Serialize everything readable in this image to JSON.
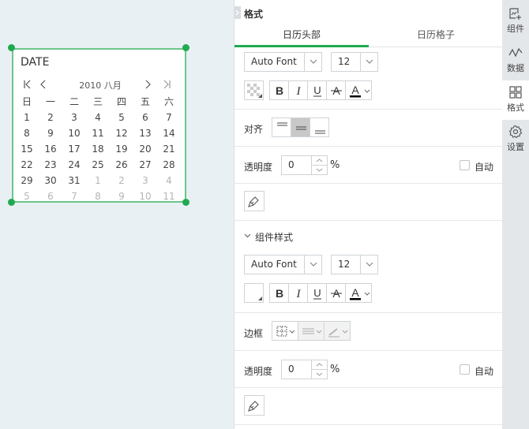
{
  "calendar": {
    "title": "DATE",
    "month_label": "2010 八月",
    "weekdays": [
      "日",
      "一",
      "二",
      "三",
      "四",
      "五",
      "六"
    ],
    "weeks": [
      [
        {
          "d": "1",
          "dim": false
        },
        {
          "d": "2",
          "dim": false
        },
        {
          "d": "3",
          "dim": false
        },
        {
          "d": "4",
          "dim": false
        },
        {
          "d": "5",
          "dim": false
        },
        {
          "d": "6",
          "dim": false
        },
        {
          "d": "7",
          "dim": false
        }
      ],
      [
        {
          "d": "8",
          "dim": false
        },
        {
          "d": "9",
          "dim": false
        },
        {
          "d": "10",
          "dim": false
        },
        {
          "d": "11",
          "dim": false
        },
        {
          "d": "12",
          "dim": false
        },
        {
          "d": "13",
          "dim": false
        },
        {
          "d": "14",
          "dim": false
        }
      ],
      [
        {
          "d": "15",
          "dim": false
        },
        {
          "d": "16",
          "dim": false
        },
        {
          "d": "17",
          "dim": false
        },
        {
          "d": "18",
          "dim": false
        },
        {
          "d": "19",
          "dim": false
        },
        {
          "d": "20",
          "dim": false
        },
        {
          "d": "21",
          "dim": false
        }
      ],
      [
        {
          "d": "22",
          "dim": false
        },
        {
          "d": "23",
          "dim": false
        },
        {
          "d": "24",
          "dim": false
        },
        {
          "d": "25",
          "dim": false
        },
        {
          "d": "26",
          "dim": false
        },
        {
          "d": "27",
          "dim": false
        },
        {
          "d": "28",
          "dim": false
        }
      ],
      [
        {
          "d": "29",
          "dim": false
        },
        {
          "d": "30",
          "dim": false
        },
        {
          "d": "31",
          "dim": false
        },
        {
          "d": "1",
          "dim": true
        },
        {
          "d": "2",
          "dim": true
        },
        {
          "d": "3",
          "dim": true
        },
        {
          "d": "4",
          "dim": true
        }
      ],
      [
        {
          "d": "5",
          "dim": true
        },
        {
          "d": "6",
          "dim": true
        },
        {
          "d": "7",
          "dim": true
        },
        {
          "d": "8",
          "dim": true
        },
        {
          "d": "9",
          "dim": true
        },
        {
          "d": "10",
          "dim": true
        },
        {
          "d": "11",
          "dim": true
        }
      ]
    ]
  },
  "panel": {
    "title": "格式",
    "tabs": [
      {
        "label": "日历头部",
        "active": true
      },
      {
        "label": "日历格子",
        "active": false
      }
    ],
    "header_section": {
      "font_family": "Auto Font",
      "font_size": "12",
      "align_label": "对齐",
      "opacity_label": "透明度",
      "opacity_value": "0",
      "opacity_unit": "%",
      "auto_label": "自动"
    },
    "widget_style_section": {
      "title": "组件样式",
      "font_family": "Auto Font",
      "font_size": "12",
      "border_label": "边框",
      "opacity_label": "透明度",
      "opacity_value": "0",
      "opacity_unit": "%",
      "auto_label": "自动"
    }
  },
  "sidebar": {
    "items": [
      {
        "label": "组件",
        "icon": "add-component-icon",
        "active": false
      },
      {
        "label": "数据",
        "icon": "data-icon",
        "active": false
      },
      {
        "label": "格式",
        "icon": "format-icon",
        "active": true
      },
      {
        "label": "设置",
        "icon": "gear-icon",
        "active": false
      }
    ]
  },
  "colors": {
    "accent": "#1faa4f",
    "selection_border": "#6bc68a",
    "canvas_bg": "#e9f0f3"
  }
}
